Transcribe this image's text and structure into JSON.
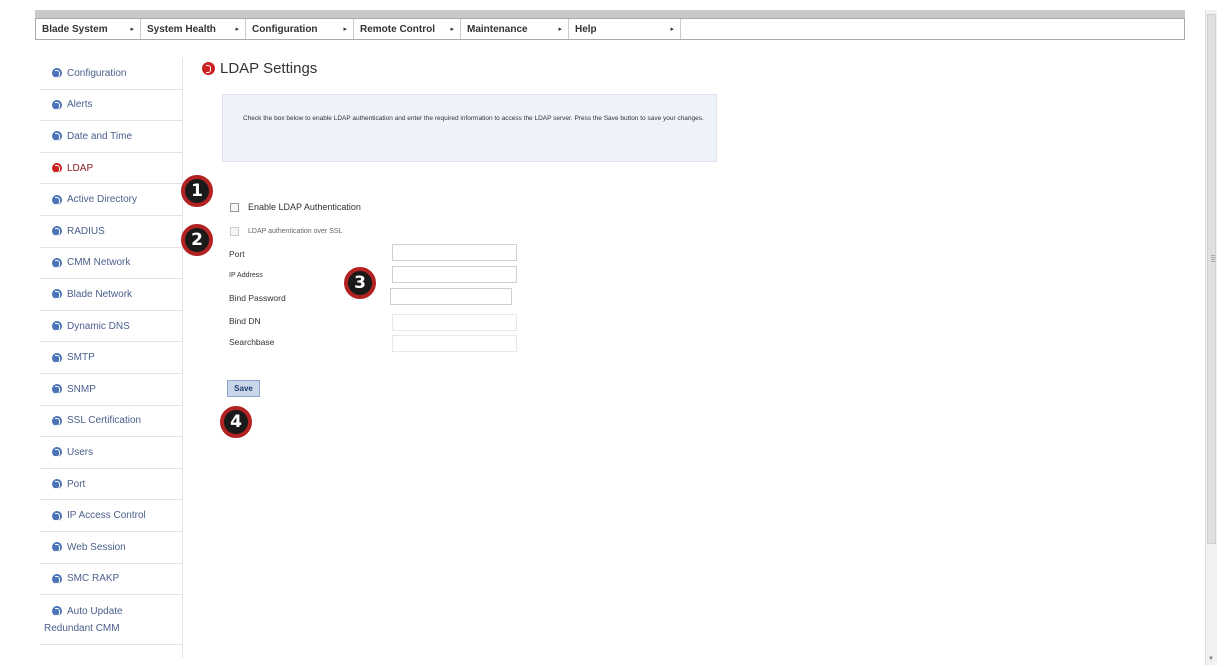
{
  "menubar": {
    "items": [
      {
        "label": "Blade System",
        "arrow": "▸"
      },
      {
        "label": "System Health",
        "arrow": "▸"
      },
      {
        "label": "Configuration",
        "arrow": "▸"
      },
      {
        "label": "Remote Control",
        "arrow": "▸"
      },
      {
        "label": "Maintenance",
        "arrow": "▸"
      },
      {
        "label": "Help",
        "arrow": "▸"
      }
    ]
  },
  "sidebar": {
    "items": [
      {
        "label": "Configuration"
      },
      {
        "label": "Alerts"
      },
      {
        "label": "Date and Time"
      },
      {
        "label": "LDAP"
      },
      {
        "label": "Active Directory"
      },
      {
        "label": "RADIUS"
      },
      {
        "label": "CMM Network"
      },
      {
        "label": "Blade Network"
      },
      {
        "label": "Dynamic DNS"
      },
      {
        "label": "SMTP"
      },
      {
        "label": "SNMP"
      },
      {
        "label": "SSL Certification"
      },
      {
        "label": "Users"
      },
      {
        "label": "Port"
      },
      {
        "label": "IP Access Control"
      },
      {
        "label": "Web Session"
      },
      {
        "label": "SMC RAKP"
      },
      {
        "label": "Auto Update"
      }
    ],
    "extra_label": "Redundant CMM"
  },
  "page": {
    "title": "LDAP Settings",
    "info": "Check the box below to enable LDAP authentication and enter the required information to access the LDAP server. Press the Save button to save your changes."
  },
  "form": {
    "enable_label": "Enable LDAP Authentication",
    "ssl_label": "LDAP authentication over SSL",
    "fields": {
      "port": {
        "label": "Port",
        "value": ""
      },
      "ip": {
        "label": "IP Address",
        "value": ""
      },
      "bind_password": {
        "label": "Bind Password",
        "value": ""
      },
      "bind_dn": {
        "label": "Bind DN",
        "value": ""
      },
      "searchbase": {
        "label": "Searchbase",
        "value": ""
      }
    },
    "save_label": "Save"
  },
  "callouts": [
    "1",
    "2",
    "3",
    "4"
  ],
  "colors": {
    "accent_red": "#cc2222",
    "link_blue": "#4a73b8",
    "info_bg": "#eef3fa"
  }
}
